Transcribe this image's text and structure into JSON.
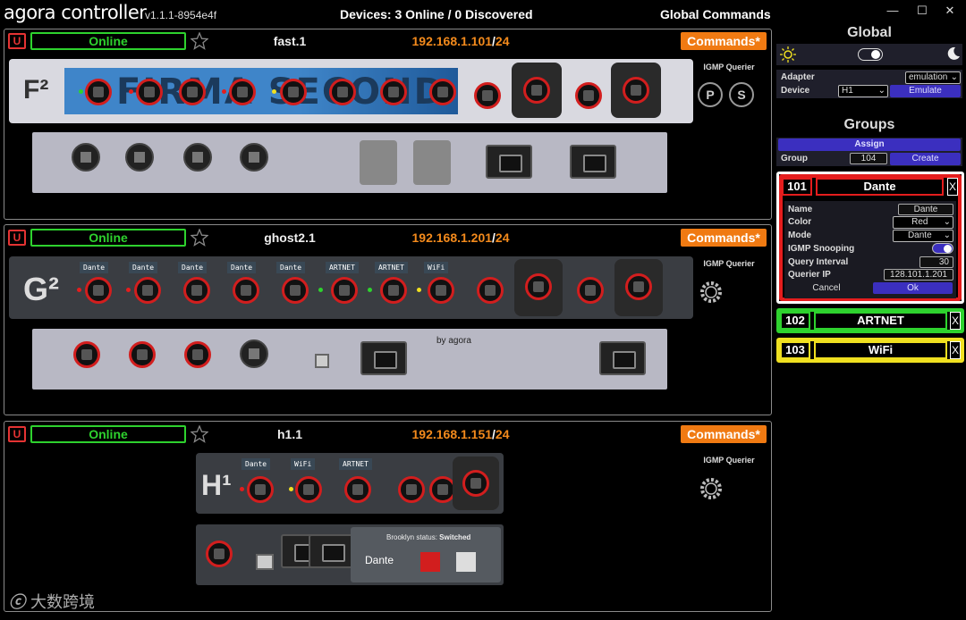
{
  "app": {
    "logo": "agora controller",
    "version": "v1.1.1-8954e4f",
    "devices_status": "Devices: 3 Online / 0 Discovered",
    "global_commands": "Global Commands",
    "window_controls": [
      "—",
      "☐",
      "✕"
    ]
  },
  "devices": [
    {
      "u": "U",
      "status": "Online",
      "name": "fast.1",
      "ip": "192.168.1.101",
      "mask": "24",
      "commands": "Commands*",
      "igmp_label": "IGMP Querier",
      "badges": [
        "P",
        "S"
      ],
      "front_logo": "F²",
      "front_text": "FIRMA SECOND",
      "tags": []
    },
    {
      "u": "U",
      "status": "Online",
      "name": "ghost2.1",
      "ip": "192.168.1.201",
      "mask": "24",
      "commands": "Commands*",
      "igmp_label": "IGMP Querier",
      "badges": [],
      "front_logo": "G²",
      "tags": [
        "Dante",
        "Dante",
        "Dante",
        "Dante",
        "Dante",
        "ARTNET",
        "ARTNET",
        "WiFi"
      ],
      "rear_brand": "by agora"
    },
    {
      "u": "U",
      "status": "Online",
      "name": "h1.1",
      "ip": "192.168.1.151",
      "mask": "24",
      "commands": "Commands*",
      "igmp_label": "IGMP Querier",
      "badges": [],
      "front_logo": "H¹",
      "tags": [
        "Dante",
        "WiFi",
        "ARTNET"
      ],
      "rear_status_label": "Brooklyn status:",
      "rear_status_value": "Switched",
      "rear_dante": "Dante"
    }
  ],
  "sidebar": {
    "global_title": "Global",
    "adapter_label": "Adapter",
    "adapter_value": "emulation",
    "device_label": "Device",
    "device_value": "H1",
    "emulate_label": "Emulate",
    "groups_title": "Groups",
    "assign_label": "Assign",
    "group_label": "Group",
    "group_value": "104",
    "create_label": "Create",
    "groups": [
      {
        "num": "101",
        "name": "Dante",
        "color": "#e51d1d",
        "x": "X"
      },
      {
        "num": "102",
        "name": "ARTNET",
        "color": "#2ed22e",
        "x": "X"
      },
      {
        "num": "103",
        "name": "WiFi",
        "color": "#f0e020",
        "x": "X"
      }
    ],
    "editor": {
      "name_label": "Name",
      "name_value": "Dante",
      "color_label": "Color",
      "color_value": "Red",
      "mode_label": "Mode",
      "mode_value": "Dante",
      "igmp_label": "IGMP Snooping",
      "interval_label": "Query Interval",
      "interval_value": "30",
      "querier_label": "Querier IP",
      "querier_value": "128.101.1.201",
      "cancel_label": "Cancel",
      "ok_label": "Ok"
    }
  },
  "watermark": "大数跨境",
  "colors": {
    "online": "#2ed22e",
    "orange": "#f38a1c",
    "red": "#e51d1d",
    "purple": "#3b2fbf"
  }
}
